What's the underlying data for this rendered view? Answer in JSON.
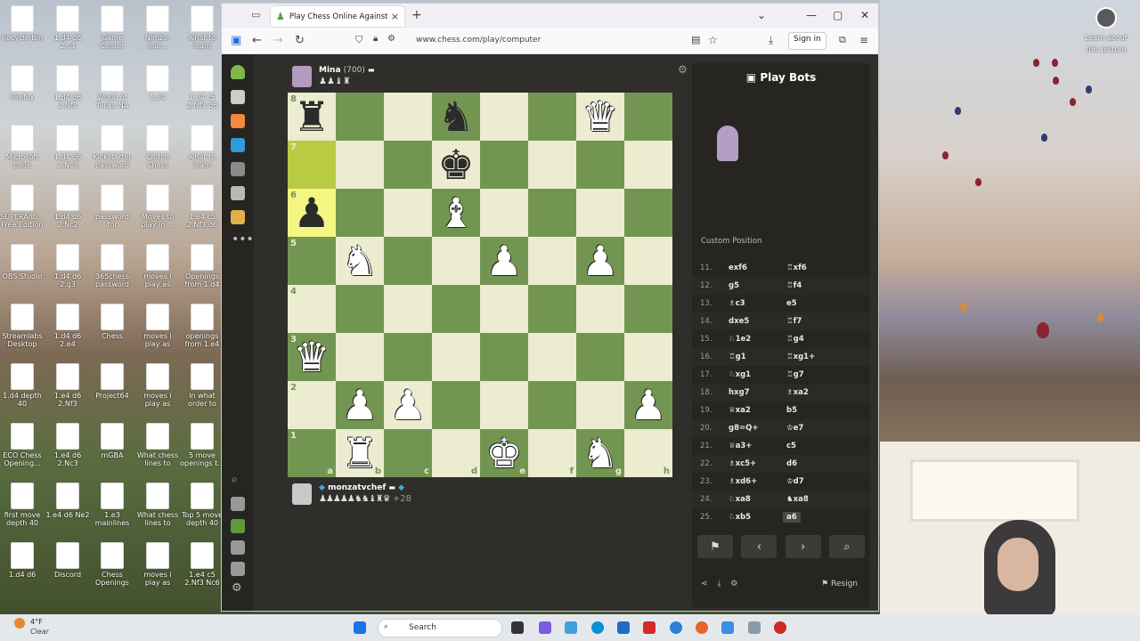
{
  "desktop": {
    "weather_temp": "4°F",
    "weather_desc": "Clear",
    "learn_label": "Learn about this picture",
    "icons_col1": [
      "Recycle Bin",
      "Firefox",
      "Microsoft Edge",
      "SUPERAnti... Free Edition",
      "OBS Studio",
      "Streamlabs Desktop",
      "1.d4 depth 40",
      "ECO Chess Opening...",
      "first move depth 40",
      "1.d4 d6"
    ],
    "icons_col2": [
      "1.d4 d6 2.c4",
      "1.d4 d6 2.Nf3",
      "1.d4 d6 2.Nc3",
      "1.d4 d6 2.Nc2",
      "1.d4 d6 2.g3",
      "1.d4 d6 2.e4",
      "1.e4 d6 2.Nf3",
      "1.e4 d6 2.Nc3",
      "1.e4 d6 Ne2",
      "Discord"
    ],
    "icons_col3": [
      "Game Center",
      "World of Tanks NA",
      "Kickstarter password",
      "password for inboxdollars",
      "365chess password",
      "Chess",
      "Project64",
      "mGBA",
      "1.e3 mainlines",
      "Chess Openings"
    ],
    "icons_col4": [
      "Nimzo-Indi... Defense t...",
      "1.e4",
      "Clutch Chess",
      "Moves to play in ...",
      "moves i play as white",
      "moves i play as black",
      "moves i play as white.md",
      "What chess lines to lea...",
      "What chess lines to lea...",
      "moves i play as black.md"
    ],
    "icons_col5": [
      "what to learn recently",
      "1.e4 c5 2.Nf3 d6 3.d4 c...",
      "what to learn recentlymd",
      "1.e4 c5 2.Nf3 d6 3.Bb4 c...",
      "Openings from 1.d4",
      "openings from 1.e4",
      "In what order to learn the ...",
      "5 move openings t...",
      "Top 5 move depth 40",
      "1.e4 c5 2.Nf3 Nc6 3.Bb5"
    ]
  },
  "browser": {
    "tab_title": "Play Chess Online Against the C",
    "url": "www.chess.com/play/computer",
    "signin_label": "Sign in"
  },
  "game": {
    "top_player": {
      "name": "Mina",
      "rating": "(700)",
      "captures": "♟♟♝♜"
    },
    "bottom_player": {
      "name": "monzatvchef",
      "captures": "♟♟♟♟♟♞♞♝♜♛",
      "advantage": "+28"
    },
    "ranks": [
      "8",
      "7",
      "6",
      "5",
      "4",
      "3",
      "2",
      "1"
    ],
    "files": [
      "a",
      "b",
      "c",
      "d",
      "e",
      "f",
      "g",
      "h"
    ],
    "board": [
      [
        "bR",
        "",
        "",
        "bN",
        "",
        "",
        "wQ",
        ""
      ],
      [
        "",
        "",
        "",
        "bK",
        "",
        "",
        "",
        ""
      ],
      [
        "bP",
        "",
        "",
        "wB",
        "",
        "",
        "",
        ""
      ],
      [
        "",
        "wN",
        "",
        "",
        "wP",
        "",
        "wP",
        ""
      ],
      [
        "",
        "",
        "",
        "",
        "",
        "",
        "",
        ""
      ],
      [
        "wQ",
        "",
        "",
        "",
        "",
        "",
        "",
        ""
      ],
      [
        "",
        "wP",
        "wP",
        "",
        "",
        "",
        "",
        "wP"
      ],
      [
        "",
        "wR",
        "",
        "",
        "wK",
        "",
        "wN",
        ""
      ]
    ],
    "highlights": [
      "a7",
      "a6"
    ]
  },
  "panel": {
    "title": "Play Bots",
    "custom_position": "Custom Position",
    "resign_label": "Resign",
    "moves": [
      {
        "num": "11.",
        "w": "exf6",
        "b": "♖xf6"
      },
      {
        "num": "12.",
        "w": "g5",
        "b": "♖f4"
      },
      {
        "num": "13.",
        "w": "♗c3",
        "b": "e5"
      },
      {
        "num": "14.",
        "w": "dxe5",
        "b": "♖f7"
      },
      {
        "num": "15.",
        "w": "♘1e2",
        "b": "♖g4"
      },
      {
        "num": "16.",
        "w": "♖g1",
        "b": "♖xg1+"
      },
      {
        "num": "17.",
        "w": "♘xg1",
        "b": "♖g7"
      },
      {
        "num": "18.",
        "w": "hxg7",
        "b": "♗xa2"
      },
      {
        "num": "19.",
        "w": "♕xa2",
        "b": "b5"
      },
      {
        "num": "20.",
        "w": "g8=Q+",
        "b": "♔e7"
      },
      {
        "num": "21.",
        "w": "♕a3+",
        "b": "c5"
      },
      {
        "num": "22.",
        "w": "♗xc5+",
        "b": "d6"
      },
      {
        "num": "23.",
        "w": "♗xd6+",
        "b": "♔d7"
      },
      {
        "num": "24.",
        "w": "♘xa8",
        "b": "♞xa8"
      },
      {
        "num": "25.",
        "w": "♘xb5",
        "b": "a6"
      }
    ]
  },
  "taskbar": {
    "search_label": "Search"
  }
}
